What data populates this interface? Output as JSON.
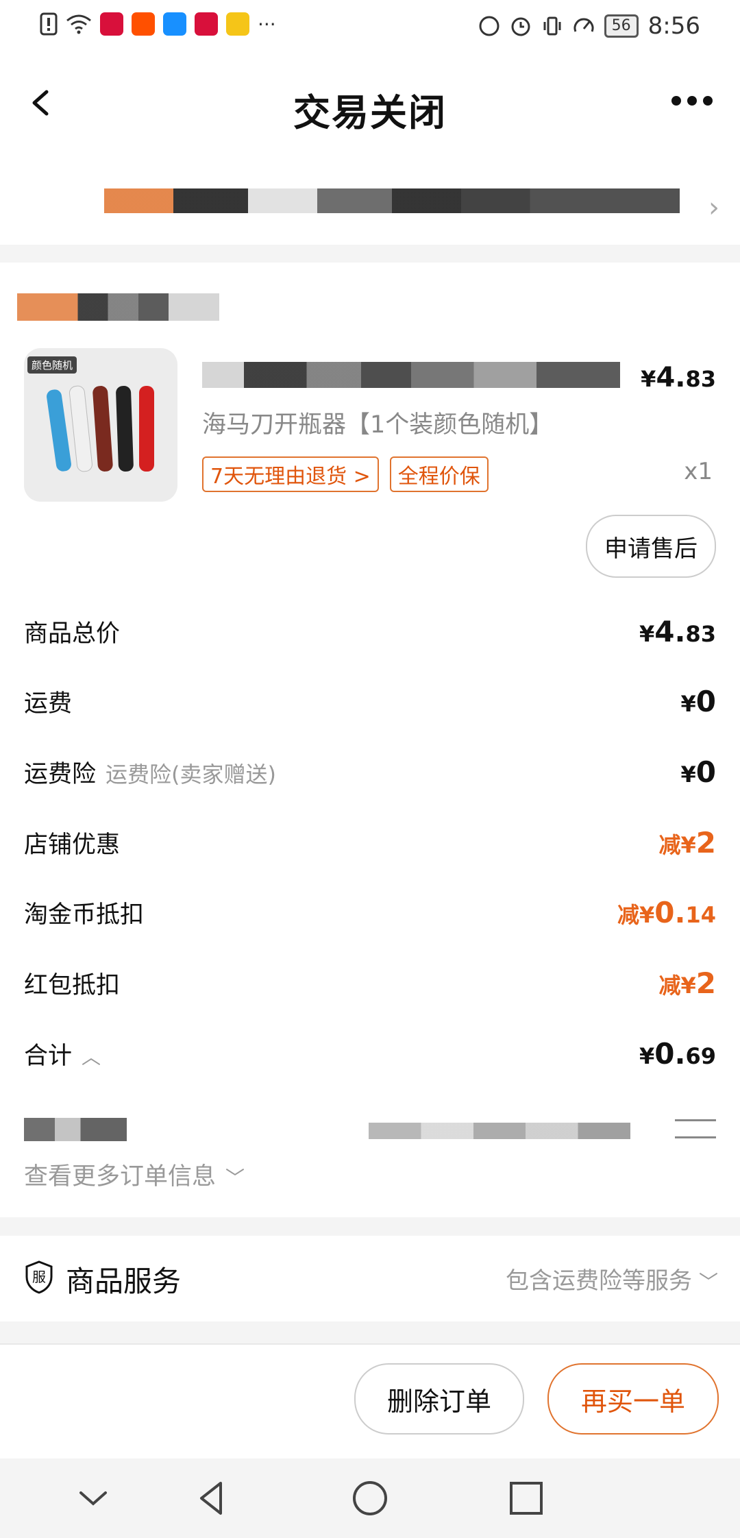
{
  "status_bar": {
    "time": "8:56",
    "battery": "56",
    "more": "···",
    "app_icons": [
      "warning-icon",
      "wifi-icon",
      "tmall-icon",
      "taobao-icon",
      "app-icon",
      "tmall-icon",
      "wallet-icon"
    ],
    "colors": {
      "tmall": "#d8103b",
      "taobao": "#ff5000",
      "app": "#1890ff",
      "wallet": "#f5c518"
    }
  },
  "header": {
    "title": "交易关闭"
  },
  "product": {
    "image_tag": "颜色随机",
    "name": "海马刀开瓶器【1个装颜色随机】",
    "price_yen": "¥",
    "price_int": "4.",
    "price_dec": "83",
    "tags": [
      "7天无理由退货 >",
      "全程价保"
    ],
    "quantity": "x1",
    "aftersale_button": "申请售后"
  },
  "summary": [
    {
      "label": "商品总价",
      "sub": "",
      "prefix": "",
      "yen": "¥",
      "int": "4.",
      "dec": "83",
      "orange": false
    },
    {
      "label": "运费",
      "sub": "",
      "prefix": "",
      "yen": "¥",
      "int": "0",
      "dec": "",
      "orange": false
    },
    {
      "label": "运费险",
      "sub": "运费险(卖家赠送)",
      "prefix": "",
      "yen": "¥",
      "int": "0",
      "dec": "",
      "orange": false
    },
    {
      "label": "店铺优惠",
      "sub": "",
      "prefix": "减",
      "yen": "¥",
      "int": "2",
      "dec": "",
      "orange": true
    },
    {
      "label": "淘金币抵扣",
      "sub": "",
      "prefix": "减",
      "yen": "¥",
      "int": "0.",
      "dec": "14",
      "orange": true
    },
    {
      "label": "红包抵扣",
      "sub": "",
      "prefix": "减",
      "yen": "¥",
      "int": "2",
      "dec": "",
      "orange": true
    },
    {
      "label": "合计",
      "sub": "",
      "prefix": "",
      "yen": "¥",
      "int": "0.",
      "dec": "69",
      "orange": false
    }
  ],
  "more_info": "查看更多订单信息",
  "service": {
    "label": "商品服务",
    "icon_char": "服",
    "detail": "包含运费险等服务"
  },
  "actions": {
    "delete": "删除订单",
    "rebuy": "再买一单"
  },
  "colors": {
    "accent": "#e8641b",
    "border": "#e0732e"
  }
}
